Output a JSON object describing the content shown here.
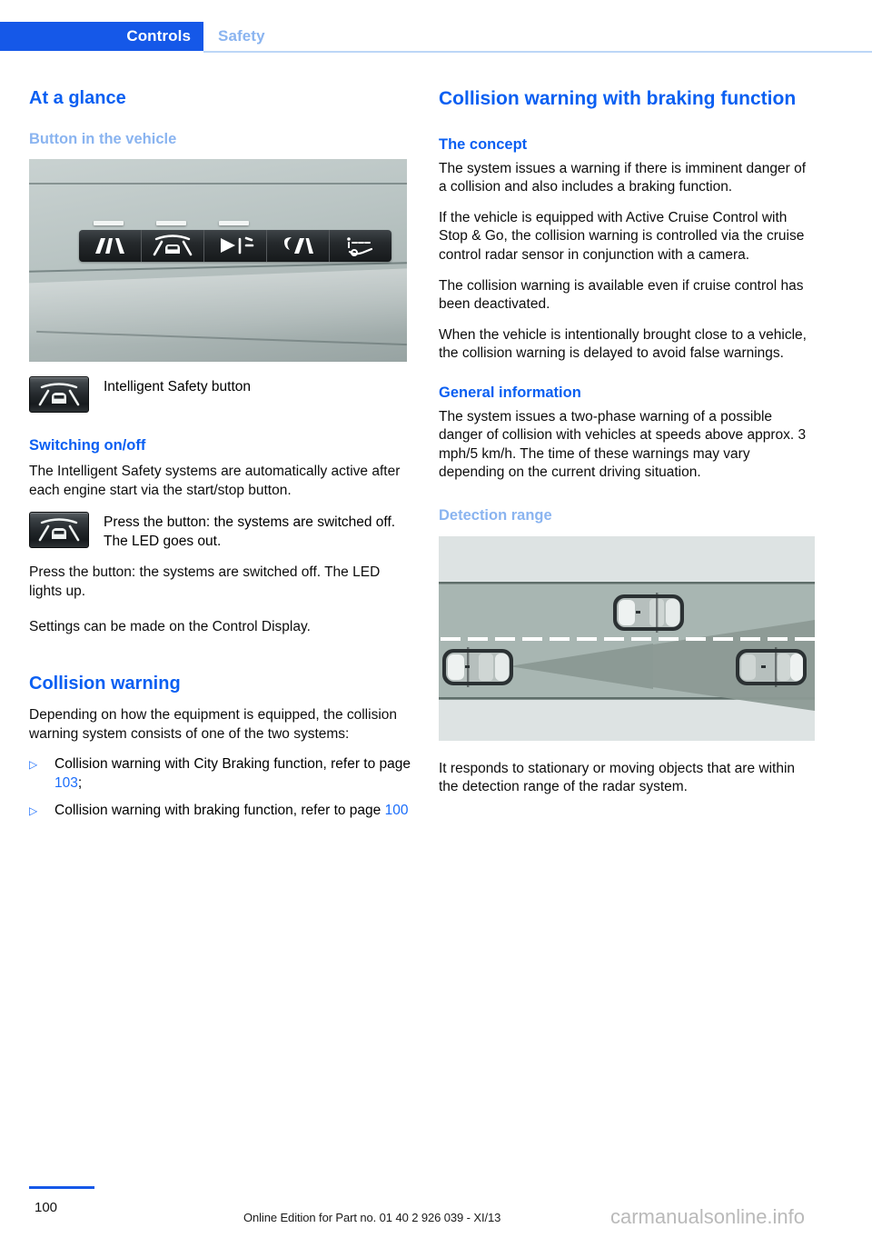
{
  "header": {
    "tab_active": "Controls",
    "tab_inactive": "Safety",
    "active_color": "#1558e8",
    "inactive_color": "#8ab4f0"
  },
  "left_column": {
    "title": "At a glance",
    "section_button": {
      "heading": "Button in the vehicle",
      "photo_alt": "Intelligent Safety button row on vehicle console",
      "caption_icon": "intelligent-safety-button-icon",
      "caption": "Intelligent Safety button"
    },
    "section_switching": {
      "heading": "Switching on/off",
      "paragraph_1": "The Intelligent Safety systems are automatically active after each engine start via the start/stop button.",
      "icon_caption": "Press the button: the systems are switched off. The LED goes out.",
      "paragraph_2": "Press the button: the systems are switched off. The LED lights up.",
      "paragraph_3": "Settings can be made on the Control Display."
    },
    "section_collision": {
      "heading": "Collision warning",
      "intro": "Depending on how the equipment is equipped, the collision warning system consists of one of the two systems:",
      "bullet_mark": "▷",
      "bullets": [
        {
          "text_before": "Collision warning with City Braking function, refer to page ",
          "page": "103",
          "text_after": ";"
        },
        {
          "text_before": "Collision warning with braking function, refer to page ",
          "page": "100",
          "text_after": ""
        }
      ]
    }
  },
  "right_column": {
    "title": "Collision warning with braking function",
    "section_concept": {
      "heading": "The concept",
      "paragraph_1": "The system issues a warning if there is imminent danger of a collision and also includes a braking function.",
      "paragraph_2": "If the vehicle is equipped with Active Cruise Control with Stop & Go, the collision warning is controlled via the cruise control radar sensor in conjunction with a camera.",
      "paragraph_3": "The collision warning is available even if cruise control has been deactivated.",
      "paragraph_4": "When the vehicle is intentionally brought close to a vehicle, the collision warning is delayed to avoid false warnings."
    },
    "section_general": {
      "heading": "General information",
      "paragraph_1": "The system issues a two-phase warning of a possible danger of collision with vehicles at speeds above approx. 3 mph/5 km/h. The time of these warnings may vary depending on the current driving situation."
    },
    "section_detection": {
      "heading": "Detection range",
      "diagram_alt": "Top view of road with radar detection cone from host vehicle",
      "paragraph_1": "It responds to stationary or moving objects that are within the detection range of the radar system."
    }
  },
  "footer": {
    "page_number": "100",
    "edition_note": "Online Edition for Part no. 01 40 2 926 039 - XI/13",
    "watermark": "carmanualsonline.info"
  }
}
